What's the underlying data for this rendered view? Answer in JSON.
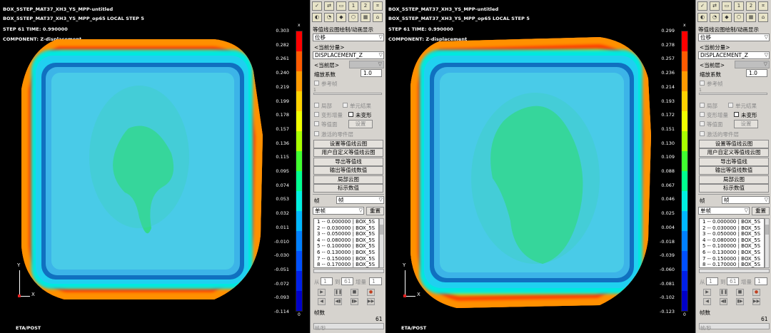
{
  "left": {
    "header": {
      "line1": "BOX_5STEP_MAT37_XH3_YS_MPP-untitled",
      "line2": "BOX_5STEP_MAT37_XH3_YS_MPP_op65  LOCAL STEP 5",
      "line3": "STEP 61    TIME:      0.990000",
      "line4": "COMPONENT: Z-displacement"
    },
    "legend": [
      "0.303",
      "0.282",
      "0.261",
      "0.240",
      "0.219",
      "0.199",
      "0.178",
      "0.157",
      "0.136",
      "0.115",
      "0.095",
      "0.074",
      "0.053",
      "0.032",
      "0.011",
      "-0.010",
      "-0.030",
      "-0.051",
      "-0.072",
      "-0.093",
      "-0.114"
    ],
    "legend_top": "x",
    "legend_bottom": "0",
    "axis_y": "Y",
    "axis_x": "X",
    "footer": "ETA/POST",
    "panel": {
      "title": "等值线云图绘制/动画显示",
      "mode_select": "位移",
      "current_component_label": "<当前分量>",
      "component_select": "DISPLACEMENT_Z",
      "current_layer_label": "<当前层>",
      "scale_label": "缩放系数",
      "scale_value": "1.0",
      "reference_frame": "参考帧",
      "slider_tick": "1",
      "cb_local": "局部",
      "cb_element": "单元结果",
      "cb_deform_incr": "变形增量",
      "cb_undeformed": "未变形",
      "cb_isosurface": "等值面",
      "btn_settings": "设置",
      "cb_active_parts": "激活的零件层",
      "buttons": [
        "设置等值线云图",
        "用户自定义等值线云图",
        "导出等值线",
        "输出等值线数值",
        "局部云图",
        "标示数值"
      ],
      "frame_label": "帧",
      "frame_select": "帧",
      "single_frame_select": "单帧",
      "reset_button": "重置",
      "frames": [
        "1 -- 0.000000 | BOX_5S",
        "2 -- 0.030000 | BOX_5S",
        "3 -- 0.050000 | BOX_5S",
        "4 -- 0.080000 | BOX_5S",
        "5 -- 0.100000 | BOX_5S",
        "6 -- 0.130000 | BOX_5S",
        "7 -- 0.150000 | BOX_5S",
        "8 -- 0.170000 | BOX_5S"
      ],
      "from_label": "从",
      "from_value": "1",
      "to_label": "到",
      "to_value": "61",
      "incr_label": "增量",
      "incr_value": "1",
      "frames_count_label": "帧数",
      "frames_count_value": "61",
      "frame_rate_label": "帧/秒"
    }
  },
  "right": {
    "header": {
      "line1": "BOX_5STEP_MAT37_XH3_YS_MPP-untitled",
      "line2": "BOX_5STEP_MAT37_XH3_YS_MPP_op65  LOCAL STEP 5",
      "line3": "STEP 61    TIME:      0.990000",
      "line4": "COMPONENT: Z-displacement"
    },
    "legend": [
      "0.299",
      "0.278",
      "0.257",
      "0.236",
      "0.214",
      "0.193",
      "0.172",
      "0.151",
      "0.130",
      "0.109",
      "0.088",
      "0.067",
      "0.046",
      "0.025",
      "0.004",
      "-0.018",
      "-0.039",
      "-0.060",
      "-0.081",
      "-0.102",
      "-0.123"
    ],
    "legend_top": "x",
    "legend_bottom": "0",
    "axis_y": "Y",
    "axis_x": "X",
    "footer": "ETA/POST",
    "panel": {
      "title": "等值线云图绘制/动画显示",
      "mode_select": "位移",
      "current_component_label": "<当前分量>",
      "component_select": "DISPLACEMENT_Z",
      "current_layer_label": "<当前层>",
      "scale_label": "缩放系数",
      "scale_value": "1.0",
      "reference_frame": "参考帧",
      "slider_tick": "1",
      "cb_local": "局部",
      "cb_element": "单元结果",
      "cb_deform_incr": "变形增量",
      "cb_undeformed": "未变形",
      "cb_isosurface": "等值面",
      "btn_settings": "设置",
      "cb_active_parts": "激活的零件层",
      "buttons": [
        "设置等值线云图",
        "用户自定义等值线云图",
        "导出等值线",
        "输出等值线数值",
        "局部云图",
        "标示数值"
      ],
      "frame_label": "帧",
      "frame_select": "帧",
      "single_frame_select": "单帧",
      "reset_button": "重置",
      "frames": [
        "1 -- 0.000000 | BOX_5S",
        "2 -- 0.030000 | BOX_5S",
        "3 -- 0.050000 | BOX_5S",
        "4 -- 0.080000 | BOX_5S",
        "5 -- 0.100000 | BOX_5S",
        "6 -- 0.130000 | BOX_5S",
        "7 -- 0.150000 | BOX_5S",
        "8 -- 0.170000 | BOX_5S"
      ],
      "from_label": "从",
      "from_value": "1",
      "to_label": "到",
      "to_value": "61",
      "incr_label": "增量",
      "incr_value": "1",
      "frames_count_label": "帧数",
      "frames_count_value": "61",
      "frame_rate_label": "帧/秒"
    }
  },
  "colors": {
    "legend_scale": [
      "#ff0000",
      "#ff5a00",
      "#ff9a00",
      "#ffd200",
      "#f0ff00",
      "#a8ff00",
      "#40ff30",
      "#00ff90",
      "#00f0e0",
      "#00b8ff",
      "#0080ff",
      "#0050ff",
      "#0020e8",
      "#0000c8"
    ],
    "background": "#000000",
    "panel_bg": "#d6d3ce"
  },
  "toolbar_icons": [
    "view-icon",
    "rotate-icon",
    "pan-icon",
    "zoom-icon",
    "frame1-icon",
    "frame2-icon",
    "fit-icon",
    "contour-icon",
    "deform-icon",
    "marker-icon",
    "part-icon",
    "mesh-icon"
  ]
}
